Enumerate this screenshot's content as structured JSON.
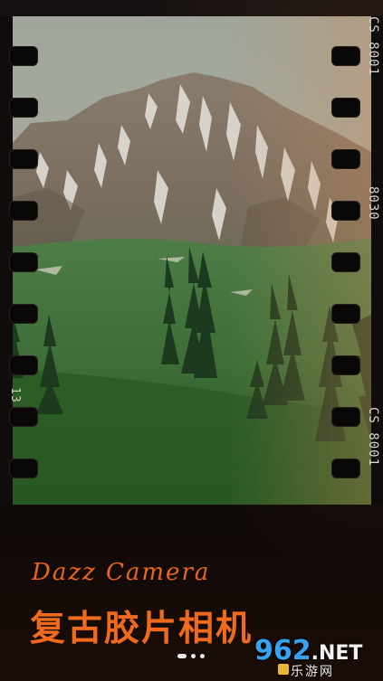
{
  "film": {
    "edge_codes_right": [
      "CS 8001",
      "8030",
      "CS 8001"
    ],
    "edge_code_left": "13",
    "photo_description_icon": "mountain-landscape-photo"
  },
  "brand": {
    "name": "Dazz Camera",
    "title_cn": "复古胶片相机",
    "accent_color": "#f06a1e"
  },
  "pager": {
    "page_count": 3,
    "active_index": 0
  },
  "watermark": {
    "logo_main": "962",
    "logo_suffix": ".NET",
    "sub_text": "乐游网"
  }
}
